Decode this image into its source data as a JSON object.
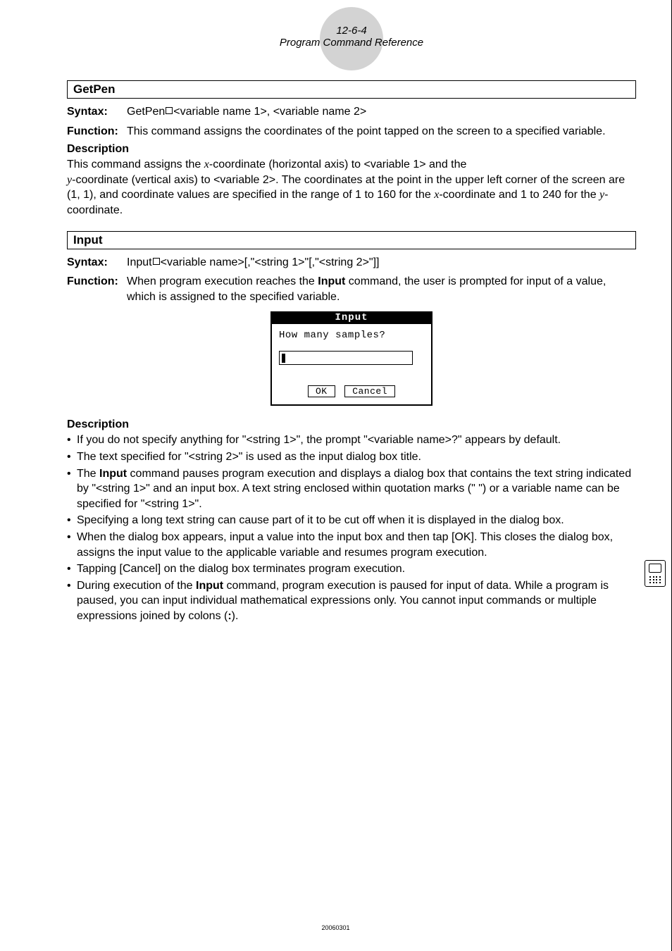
{
  "header": {
    "pagenum": "12-6-4",
    "title": "Program Command Reference"
  },
  "getpen": {
    "box_title": "GetPen",
    "syntax_label": "Syntax:",
    "syntax_text": "GetPen□<variable name 1>, <variable name 2>",
    "function_label": "Function:",
    "function_text": "This command assigns the coordinates of the point tapped on the screen to a specified variable.",
    "desc_label": "Description",
    "desc_text_1": "This command assigns the ",
    "desc_text_2": "-coordinate (horizontal axis) to <variable 1> and the ",
    "desc_text_3": "-coordinate (vertical axis) to <variable 2>. The coordinates at the point in the upper left corner of the screen are (1, 1), and coordinate values are specified in the range of 1 to 160 for the ",
    "desc_text_4": "-coordinate and 1 to 240 for the ",
    "desc_text_5": "-coordinate.",
    "var_x": "x",
    "var_y": "y"
  },
  "input": {
    "box_title": "Input",
    "syntax_label": "Syntax:",
    "syntax_text": "Input□<variable name>[,\"<string 1>\"[,\"<string 2>\"]]",
    "function_label": "Function:",
    "function_text_1": "When program execution reaches the ",
    "function_bold": "Input",
    "function_text_2": " command, the user is prompted for input of a value, which is assigned to the specified variable.",
    "dialog": {
      "title": "Input",
      "prompt": "How many samples?",
      "ok": "OK",
      "cancel": "Cancel"
    },
    "desc_label": "Description",
    "bullets": {
      "b1": "If you do not specify anything for \"<string 1>\", the prompt \"<variable name>?\" appears by default.",
      "b2": "The text specified for \"<string 2>\" is used as the input dialog box title.",
      "b3_a": "The ",
      "b3_bold": "Input",
      "b3_b": " command pauses program execution and displays a dialog box that contains the text string indicated by \"<string 1>\" and an input box. A text string enclosed within quotation marks (\" \") or a variable name can be specified for \"<string 1>\".",
      "b4": "Specifying a long text string can cause part of it to be cut off when it is displayed in the dialog box.",
      "b5": "When the dialog box appears, input a value into the input box and then tap [OK]. This closes the dialog box, assigns the input value to the applicable variable and resumes program execution.",
      "b6": "Tapping [Cancel] on the dialog box terminates program execution.",
      "b7_a": "During execution of the ",
      "b7_bold": "Input",
      "b7_b": " command, program execution is paused for input of data. While a program is paused, you can input individual mathematical expressions only. You cannot input commands or multiple expressions joined by colons (",
      "b7_bold2": ":",
      "b7_c": ")."
    }
  },
  "footer": "20060301"
}
